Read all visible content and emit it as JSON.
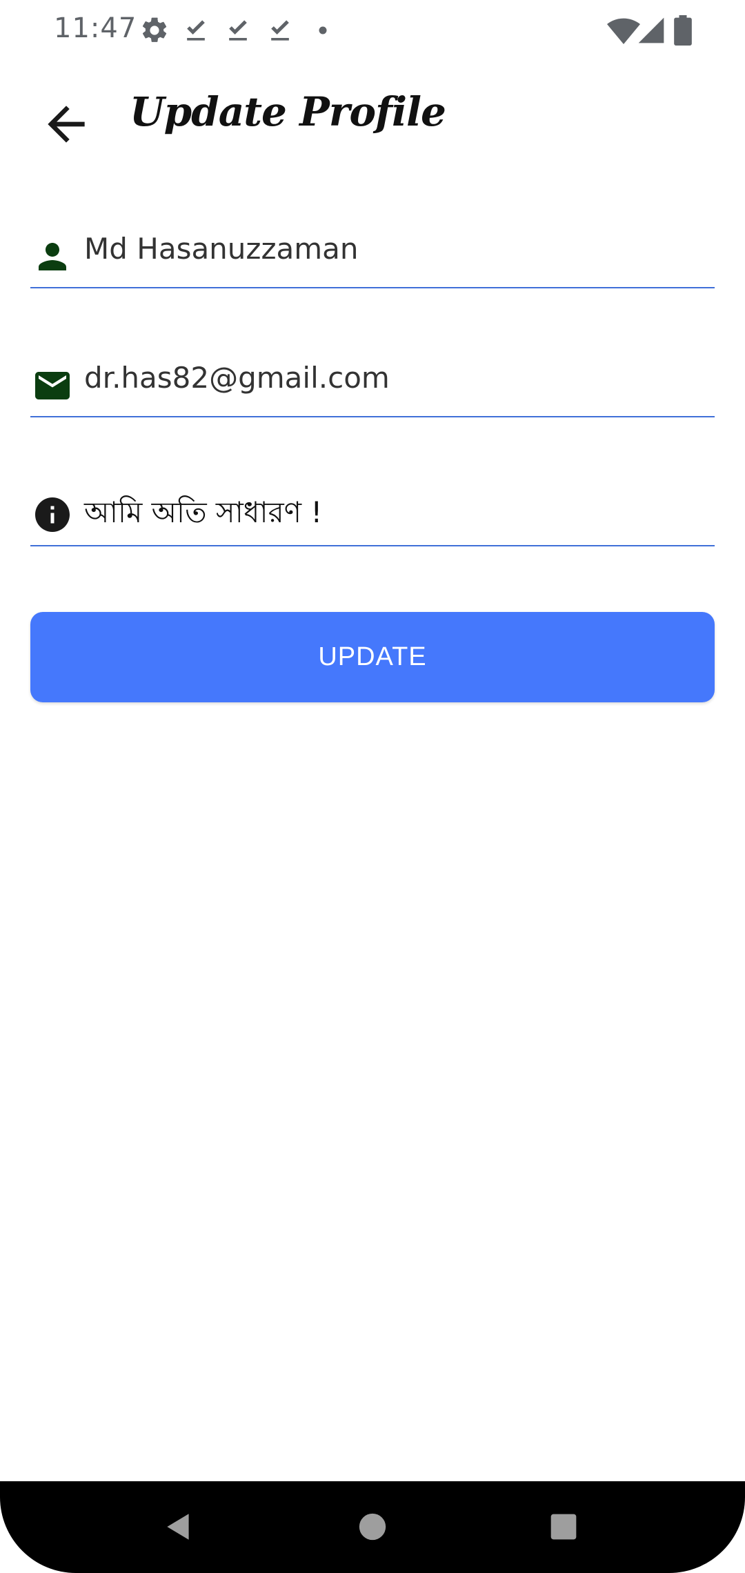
{
  "status_bar": {
    "time": "11:47",
    "icons": [
      "settings-icon",
      "download-done-icon",
      "download-done-icon",
      "download-done-icon",
      "dot-icon",
      "wifi-icon",
      "signal-icon",
      "battery-icon"
    ]
  },
  "app_bar": {
    "title": "Update Profile",
    "back_icon": "arrow-back-icon"
  },
  "form": {
    "name": {
      "value": "Md Hasanuzzaman",
      "icon": "person-icon"
    },
    "email": {
      "value": "dr.has82@gmail.com",
      "icon": "mail-icon"
    },
    "bio": {
      "value": "আমি অতি সাধারণ !",
      "icon": "info-icon"
    }
  },
  "update_button": {
    "label": "UPDATE"
  },
  "colors": {
    "accent": "#4578fc",
    "underline": "#3f6fd8",
    "field_icon": "#0b3d10"
  },
  "nav_bar": {
    "icons": [
      "nav-back-icon",
      "nav-home-icon",
      "nav-recents-icon"
    ]
  }
}
